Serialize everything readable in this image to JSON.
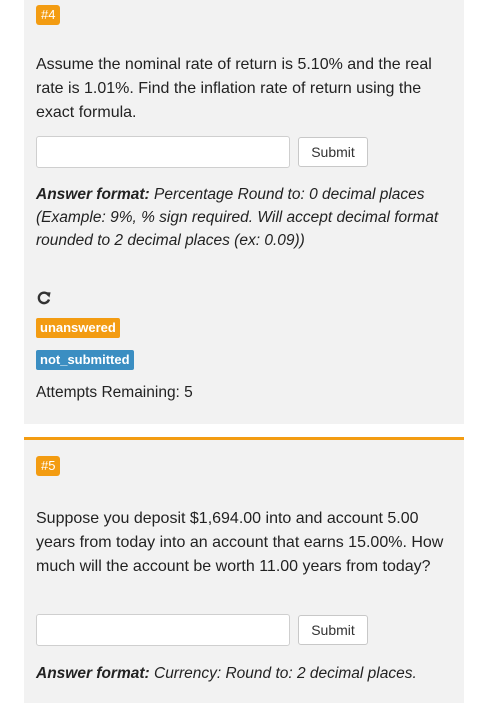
{
  "q4": {
    "badge": "#4",
    "text": "Assume the nominal rate of return is 5.10% and the real rate is 1.01%. Find the inflation rate of return using the exact formula.",
    "input_value": "",
    "submit_label": "Submit",
    "format_label": "Answer format:",
    "format_text": " Percentage Round to: 0 decimal places (Example: 9%, % sign required. Will accept decimal format rounded to 2 decimal places (ex: 0.09))",
    "status_icon": "refresh-icon",
    "status_unanswered": "unanswered",
    "status_submitted": "not_submitted",
    "attempts": "Attempts Remaining: 5"
  },
  "q5": {
    "badge": "#5",
    "text": "Suppose you deposit $1,694.00 into and account 5.00 years from today into an account that earns 15.00%. How much will the account be worth 11.00 years from today?",
    "input_value": "",
    "submit_label": "Submit",
    "format_label": "Answer format:",
    "format_text": " Currency: Round to: 2 decimal places."
  },
  "colors": {
    "accent_orange": "#f39c12",
    "status_blue": "#3b8ec2",
    "card_bg": "#f2f2f2"
  }
}
